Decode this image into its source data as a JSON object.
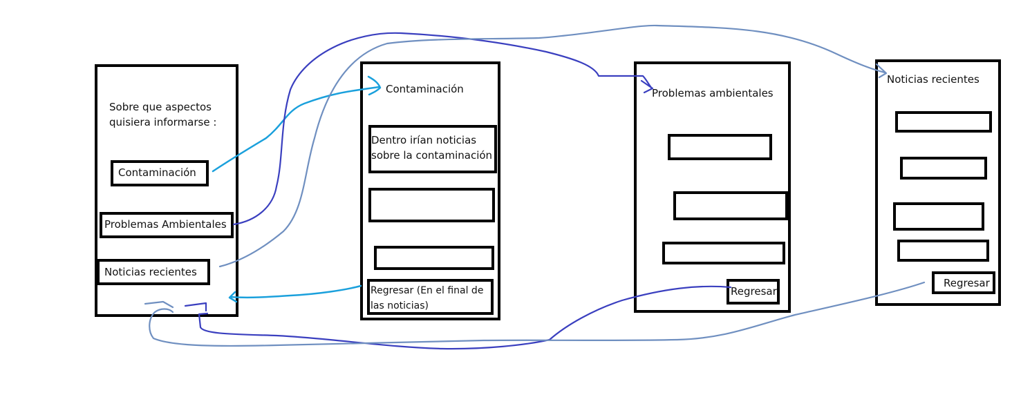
{
  "colors": {
    "arrow_contaminacion": "#1aa0dc",
    "arrow_problemas": "#3a3fbf",
    "arrow_noticias": "#6f8fc0",
    "border": "#000000"
  },
  "menu_screen": {
    "prompt": "Sobre que aspectos quisiera informarse :",
    "options": [
      {
        "label": "Contaminación"
      },
      {
        "label": "Problemas Ambientales"
      },
      {
        "label": "Noticias recientes"
      }
    ]
  },
  "contaminacion_screen": {
    "title": "Contaminación",
    "news_box_1": "Dentro irían noticias sobre la contaminación",
    "back_button": "Regresar (En el final de las noticias)"
  },
  "problemas_screen": {
    "title": "Problemas ambientales",
    "back_button": "Regresar"
  },
  "noticias_screen": {
    "title": "Noticias recientes",
    "back_button": "Regresar"
  }
}
